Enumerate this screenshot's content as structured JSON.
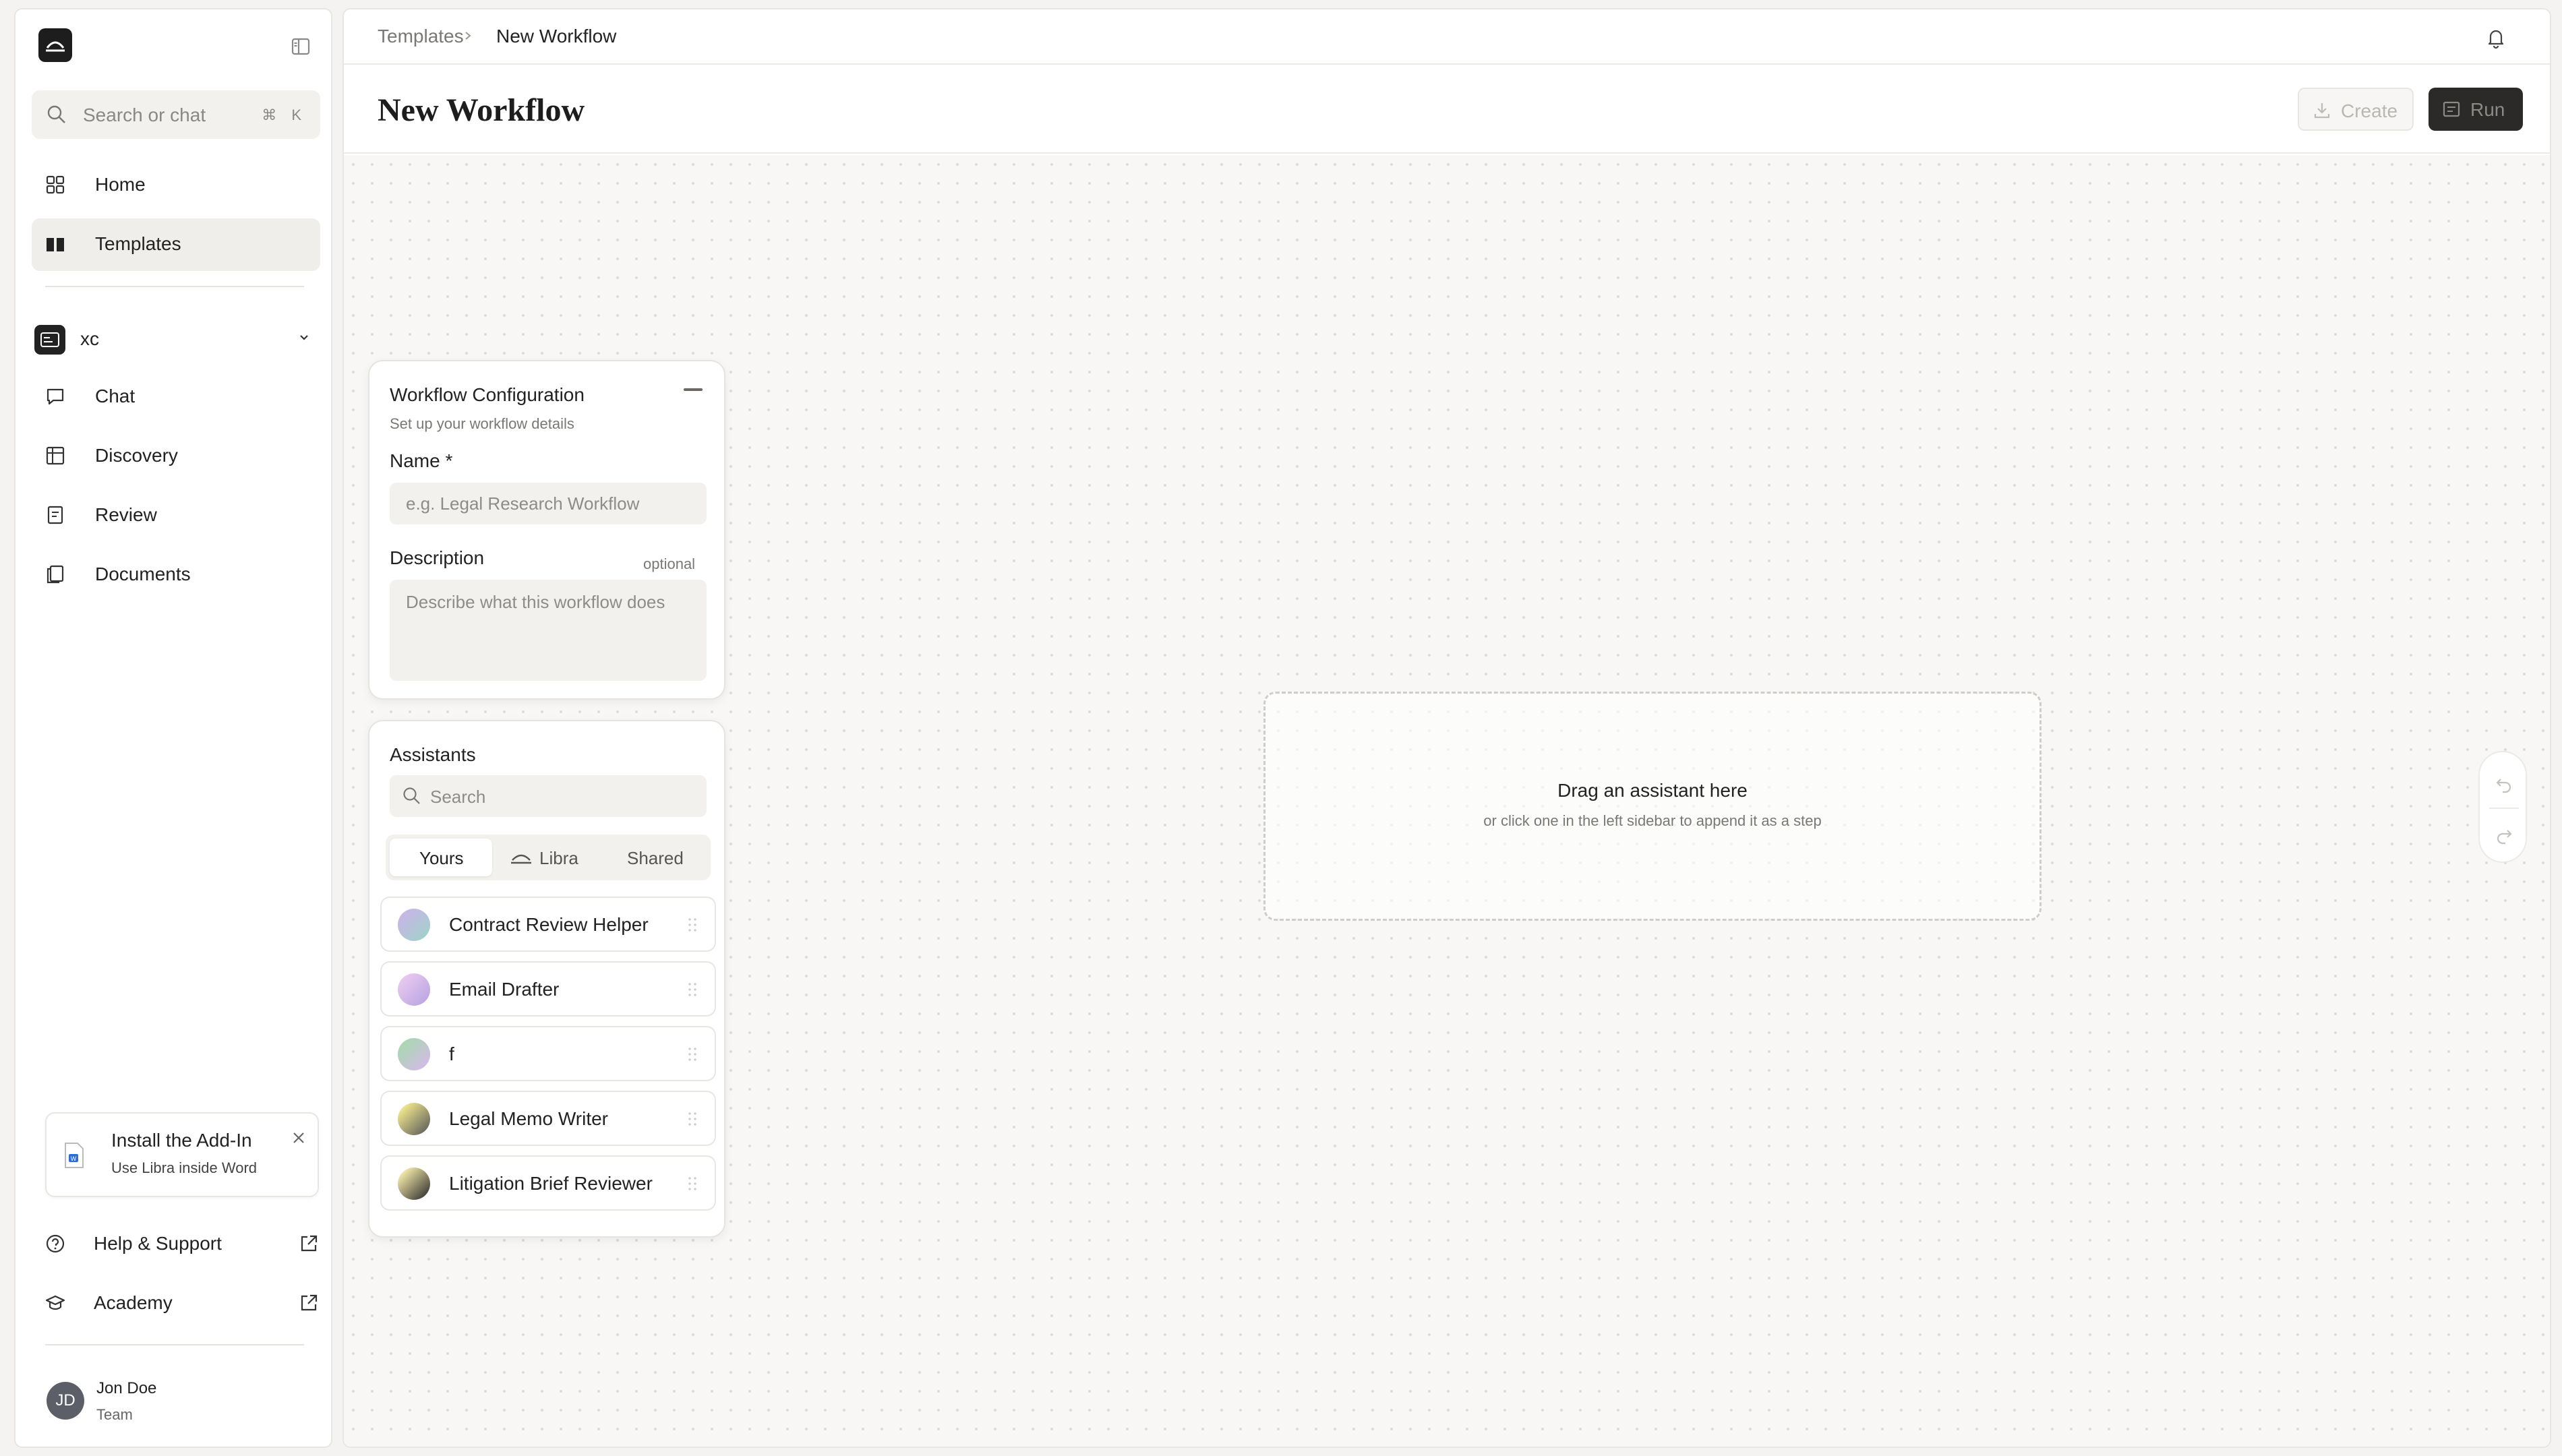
{
  "sidebar": {
    "search": {
      "placeholder": "Search or chat",
      "shortcut": "⌘ K"
    },
    "nav": [
      {
        "label": "Home",
        "icon": "grid-icon"
      },
      {
        "label": "Templates",
        "icon": "book-icon",
        "active": true
      }
    ],
    "workspace": {
      "name": "xc",
      "items": [
        {
          "label": "Chat",
          "icon": "chat-icon"
        },
        {
          "label": "Discovery",
          "icon": "table-icon"
        },
        {
          "label": "Review",
          "icon": "review-icon"
        },
        {
          "label": "Documents",
          "icon": "documents-icon"
        }
      ]
    },
    "addin": {
      "title": "Install the Add-In",
      "subtitle": "Use Libra inside Word"
    },
    "bottom_links": [
      {
        "label": "Help & Support",
        "icon": "help-icon"
      },
      {
        "label": "Academy",
        "icon": "graduation-cap-icon"
      }
    ],
    "user": {
      "initials": "JD",
      "name": "Jon Doe",
      "team": "Team"
    }
  },
  "topbar": {
    "breadcrumb": [
      "Templates",
      "New Workflow"
    ]
  },
  "header": {
    "title": "New Workflow",
    "create_label": "Create",
    "run_label": "Run"
  },
  "config": {
    "title": "Workflow Configuration",
    "subtitle": "Set up your workflow details",
    "name_label": "Name *",
    "name_placeholder": "e.g. Legal Research Workflow",
    "description_label": "Description",
    "optional_label": "optional",
    "description_placeholder": "Describe what this workflow does"
  },
  "assistants": {
    "title": "Assistants",
    "search_placeholder": "Search",
    "tabs": [
      "Yours",
      "Libra",
      "Shared"
    ],
    "active_tab": "Yours",
    "items": [
      {
        "label": "Contract Review Helper",
        "colors": [
          "#c8b6e8",
          "#9fd3c7"
        ]
      },
      {
        "label": "Email Drafter",
        "colors": [
          "#e8c8f0",
          "#b7a4e0"
        ]
      },
      {
        "label": "f",
        "colors": [
          "#a8d8b0",
          "#d8b8ec"
        ]
      },
      {
        "label": "Legal Memo Writer",
        "colors": [
          "#f0e68c",
          "#5a5a5a"
        ]
      },
      {
        "label": "Litigation Brief Reviewer",
        "colors": [
          "#f3e8a8",
          "#2e2e2e"
        ]
      }
    ]
  },
  "canvas": {
    "drop_title": "Drag an assistant here",
    "drop_subtitle": "or click one in the left sidebar to append it as a step"
  }
}
